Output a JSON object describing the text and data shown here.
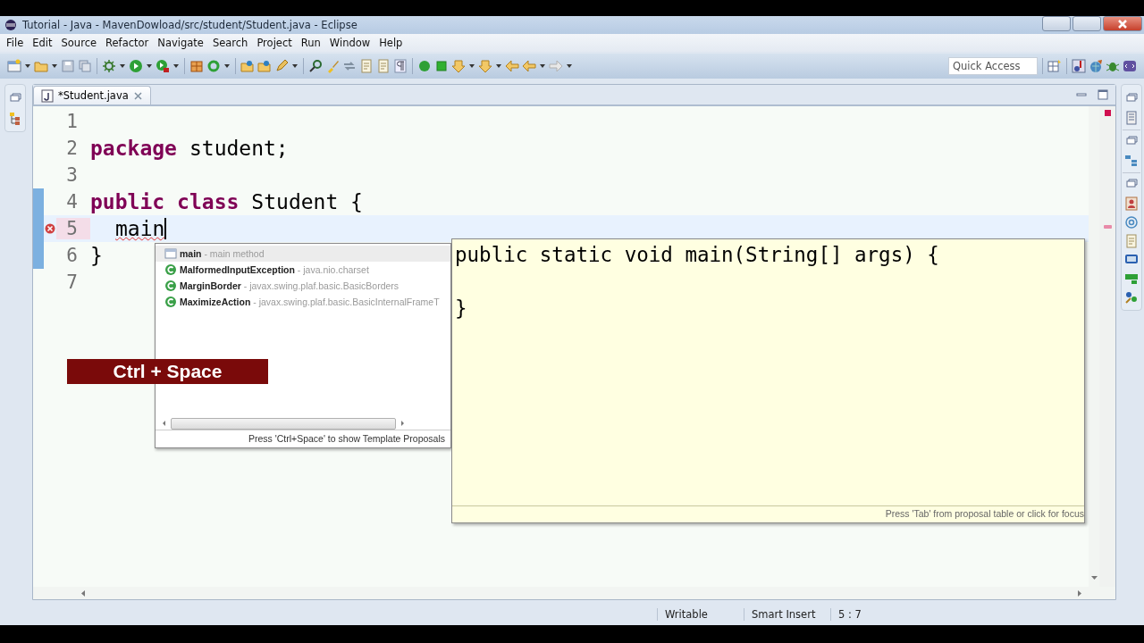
{
  "window": {
    "title": "Tutorial - Java - MavenDowload/src/student/Student.java - Eclipse"
  },
  "menu": [
    "File",
    "Edit",
    "Source",
    "Refactor",
    "Navigate",
    "Search",
    "Project",
    "Run",
    "Window",
    "Help"
  ],
  "quick_access": {
    "placeholder": "Quick Access"
  },
  "editor_tab": {
    "label": "*Student.java",
    "selected": true
  },
  "code_lines": [
    {
      "number": "1"
    },
    {
      "number": "2",
      "tokens": [
        {
          "kind": "keyword",
          "text": "package"
        },
        {
          "kind": "plain",
          "text": "student;"
        }
      ]
    },
    {
      "number": "3"
    },
    {
      "number": "4",
      "in_range": true,
      "tokens": [
        {
          "kind": "keyword",
          "text": "public"
        },
        {
          "kind": "keyword",
          "text": "class"
        },
        {
          "kind": "plain",
          "text": "Student {"
        }
      ]
    },
    {
      "number": "5",
      "in_range": true,
      "current": true,
      "error": true,
      "indented": true,
      "tokens": [
        {
          "kind": "error",
          "text": "main"
        }
      ]
    },
    {
      "number": "6",
      "in_range": true,
      "tokens": [
        {
          "kind": "plain",
          "text": "}"
        }
      ]
    },
    {
      "number": "7"
    }
  ],
  "proposals": [
    {
      "kind": "template",
      "name": "main",
      "detail": "- main method",
      "selected": true
    },
    {
      "kind": "class",
      "name": "MalformedInputException",
      "detail": "- java.nio.charset",
      "selected": false
    },
    {
      "kind": "class",
      "name": "MarginBorder",
      "detail": "- javax.swing.plaf.basic.BasicBorders",
      "selected": false
    },
    {
      "kind": "class",
      "name": "MaximizeAction",
      "detail": "- javax.swing.plaf.basic.BasicInternalFrameT",
      "selected": false
    }
  ],
  "proposal_footer": "Press 'Ctrl+Space' to show Template Proposals",
  "doc_popup": {
    "lines": [
      {
        "kind": "code",
        "text": "public static void main(String[] args) {"
      },
      {
        "kind": "blank"
      },
      {
        "kind": "code",
        "text": "}"
      }
    ],
    "footer": "Press 'Tab' from proposal table or click for focus"
  },
  "caption": "Ctrl + Space",
  "status_bar": [
    "Writable",
    "Smart Insert",
    "5 : 7"
  ]
}
